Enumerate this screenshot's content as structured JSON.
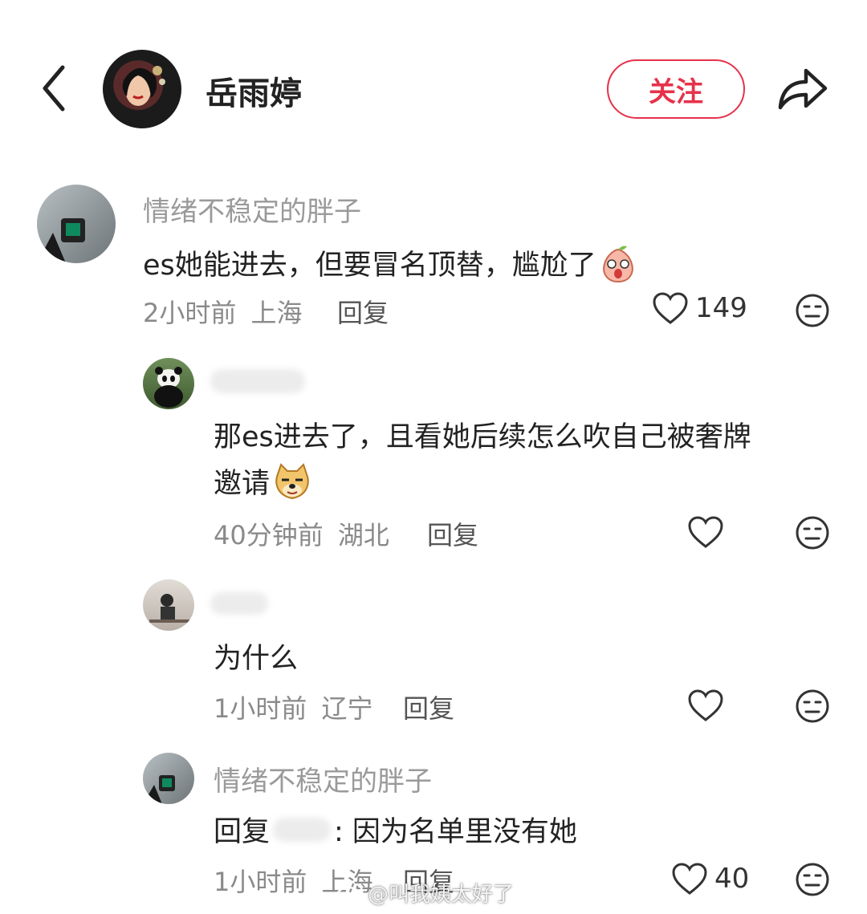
{
  "header": {
    "title": "岳雨婷",
    "follow_label": "关注",
    "accent": "#e6324b"
  },
  "comments": [
    {
      "username": "情绪不稳定的胖子",
      "text": "es她能进去，但要冒名顶替，尴尬了",
      "time": "2小时前",
      "location": "上海",
      "reply_label": "回复",
      "likes": "149"
    },
    {
      "username": "",
      "text_line1": "那es进去了，且看她后续怎么吹自己被奢牌",
      "text_line2": "邀请",
      "time": "40分钟前",
      "location": "湖北",
      "reply_label": "回复"
    },
    {
      "username": "",
      "text": "为什么",
      "time": "1小时前",
      "location": "辽宁",
      "reply_label": "回复"
    },
    {
      "username": "情绪不稳定的胖子",
      "reply_prefix": "回复",
      "text": ": 因为名单里没有她",
      "time": "1小时前",
      "location": "上海",
      "reply_label": "回复",
      "likes": "40"
    }
  ],
  "watermark": "@叫我姨太好了",
  "icons": {
    "back": "chevron-left-icon",
    "share": "share-arrow-icon",
    "like": "heart-icon",
    "dislike": "meh-face-icon"
  }
}
